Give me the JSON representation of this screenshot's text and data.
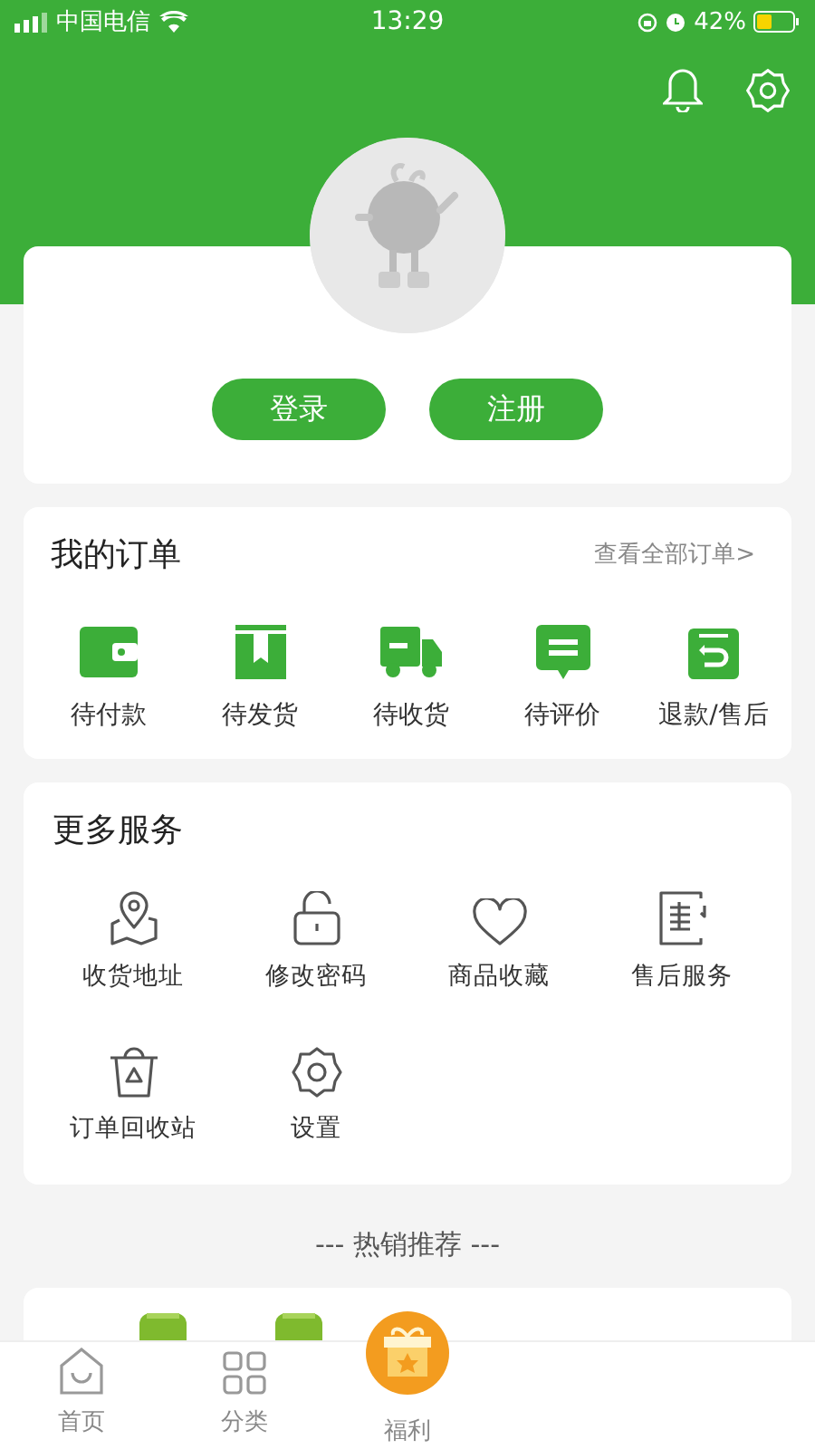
{
  "status_bar": {
    "carrier": "中国电信",
    "time": "13:29",
    "battery": "42%"
  },
  "profile": {
    "buttons": [
      "登录",
      "注册"
    ]
  },
  "orders": {
    "title": "我的订单",
    "view_all": "查看全部订单>",
    "items": [
      "待付款",
      "待发货",
      "待收货",
      "待评价",
      "退款/售后"
    ]
  },
  "services": {
    "title": "更多服务",
    "items": [
      "收货地址",
      "修改密码",
      "商品收藏",
      "售后服务",
      "订单回收站",
      "设置"
    ]
  },
  "recommend": {
    "title": "--- 热销推荐 ---"
  },
  "tab_bar": {
    "items": [
      "首页",
      "分类",
      "福利"
    ]
  }
}
